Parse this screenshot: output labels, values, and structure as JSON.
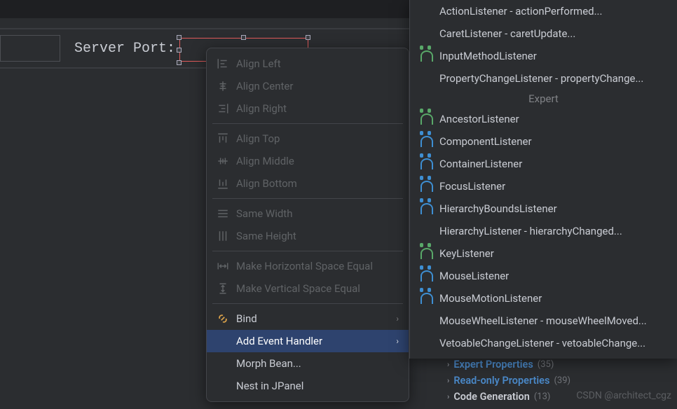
{
  "designer": {
    "label": "Server Port:"
  },
  "context_menu": {
    "align_left": "Align Left",
    "align_center": "Align Center",
    "align_right": "Align Right",
    "align_top": "Align Top",
    "align_middle": "Align Middle",
    "align_bottom": "Align Bottom",
    "same_width": "Same Width",
    "same_height": "Same Height",
    "h_space": "Make Horizontal Space Equal",
    "v_space": "Make Vertical Space Equal",
    "bind": "Bind",
    "add_handler": "Add Event Handler",
    "morph": "Morph Bean...",
    "nest": "Nest in JPanel"
  },
  "submenu": {
    "action": "ActionListener - actionPerformed...",
    "caret": "CaretListener - caretUpdate...",
    "inputmethod": "InputMethodListener",
    "propchange": "PropertyChangeListener - propertyChange...",
    "expert_heading": "Expert",
    "ancestor": "AncestorListener",
    "component": "ComponentListener",
    "container": "ContainerListener",
    "focus": "FocusListener",
    "hierbounds": "HierarchyBoundsListener",
    "hier": "HierarchyListener - hierarchyChanged...",
    "key": "KeyListener",
    "mouse": "MouseListener",
    "mousemotion": "MouseMotionListener",
    "mousewheel": "MouseWheelListener - mouseWheelMoved...",
    "vetoable": "VetoableChangeListener - vetoableChange..."
  },
  "properties": {
    "expert": {
      "label": "Expert Properties",
      "count": "(35)"
    },
    "readonly": {
      "label": "Read-only Properties",
      "count": "(39)"
    },
    "codegen": {
      "label": "Code Generation",
      "count": "(13)"
    }
  },
  "watermark": "CSDN @architect_cgz"
}
